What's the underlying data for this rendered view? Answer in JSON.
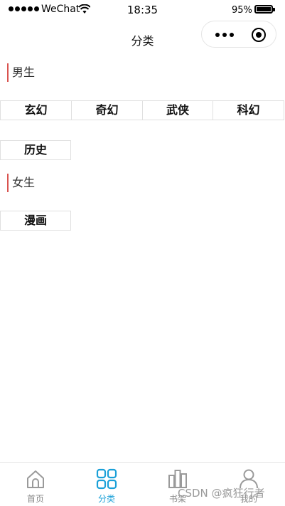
{
  "status_bar": {
    "carrier": "WeChat",
    "time": "18:35",
    "battery": "95%"
  },
  "nav": {
    "title": "分类"
  },
  "sections": [
    {
      "title": "男生",
      "items": [
        "玄幻",
        "奇幻",
        "武侠",
        "科幻",
        "历史"
      ]
    },
    {
      "title": "女生",
      "items": [
        "漫画"
      ]
    }
  ],
  "tabbar": {
    "items": [
      {
        "label": "首页",
        "icon": "home-icon",
        "active": false
      },
      {
        "label": "分类",
        "icon": "category-icon",
        "active": true
      },
      {
        "label": "书架",
        "icon": "bookshelf-icon",
        "active": false
      },
      {
        "label": "我的",
        "icon": "user-icon",
        "active": false
      }
    ],
    "active_color": "#1aa0d8",
    "inactive_color": "#888888"
  },
  "watermark": "CSDN @疯狂行者",
  "colors": {
    "accent": "#d9534f",
    "border": "#e0e0e0"
  }
}
